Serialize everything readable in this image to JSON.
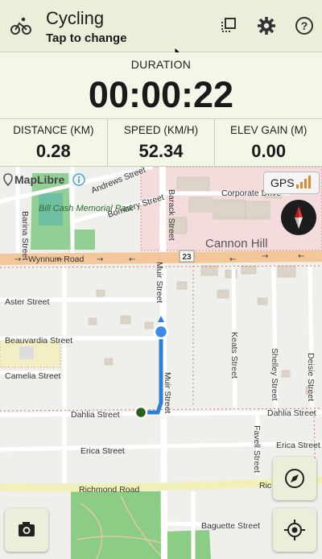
{
  "header": {
    "title": "Cycling",
    "subtitle": "Tap to change",
    "activity_icon": "bicycle-icon",
    "buttons": [
      "layers-icon",
      "gear-icon",
      "help-icon"
    ]
  },
  "duration": {
    "label": "DURATION",
    "value": "00:00:22"
  },
  "stats": [
    {
      "label": "DISTANCE (KM)",
      "value": "0.28"
    },
    {
      "label": "SPEED (KM/H)",
      "value": "52.34"
    },
    {
      "label": "ELEV GAIN (M)",
      "value": "0.00"
    }
  ],
  "map": {
    "attribution": "MapLibre",
    "gps_label": "GPS",
    "streets": {
      "andrews": "Andrews Street",
      "bombery": "Bombery Street",
      "barack": "Barack Street",
      "corporate": "Corporate Drive",
      "barina": "Barina Street",
      "park": "Bill Cash Memorial Park",
      "cannon_hill": "Cannon Hill",
      "wynnum": "Wynnum Road",
      "route_23": "23",
      "muir": "Muir Street",
      "aster": "Aster Street",
      "beauvardia": "Beauvardia Street",
      "keats": "Keats Street",
      "shelley": "Shelley Street",
      "deisie": "Deisie Street",
      "camelia": "Camelia Street",
      "dahlia_left": "Dahlia Street",
      "dahlia_right": "Dahlia Street",
      "favell": "Favell Street",
      "erica_left": "Erica Street",
      "erica_right": "Erica Street",
      "richmond": "Richmond Road",
      "richmond_cut": "Ric",
      "baguette": "Baguette Street"
    }
  },
  "fab": {
    "camera": "camera-icon",
    "compass": "compass-icon",
    "locate": "my-location-icon"
  },
  "colors": {
    "accent": "#e9efd9",
    "track": "#2f7ed8",
    "park": "#7cc47f",
    "arterial": "#f6c99b"
  }
}
